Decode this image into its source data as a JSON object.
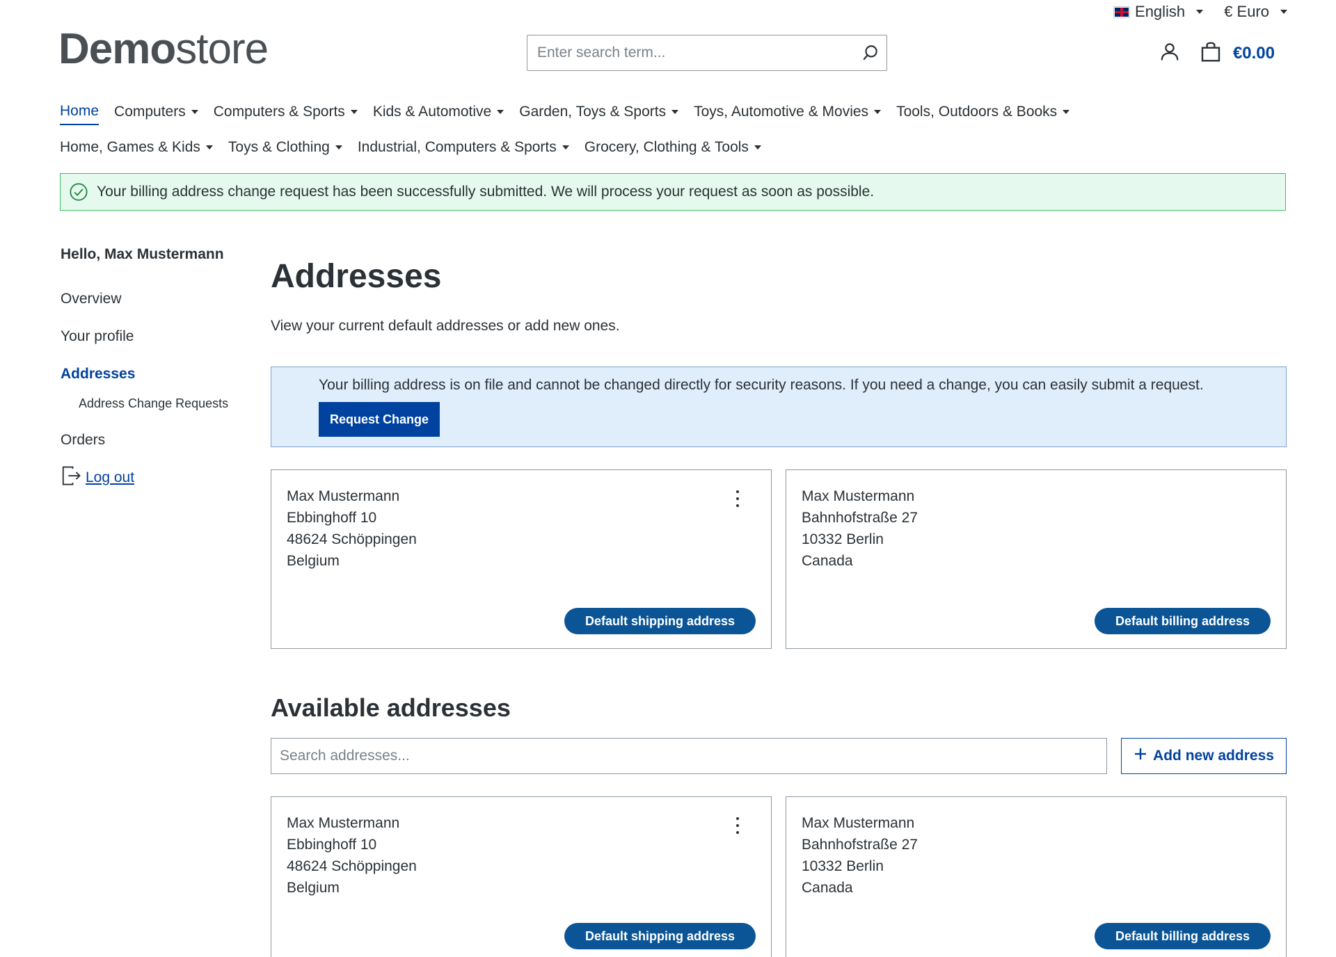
{
  "topbar": {
    "language": "English",
    "currency": "€ Euro"
  },
  "header": {
    "logo_bold": "Demo",
    "logo_light": "store",
    "search_placeholder": "Enter search term...",
    "cart_total": "€0.00"
  },
  "nav": {
    "row1": [
      {
        "label": "Home",
        "active": true
      },
      {
        "label": "Computers"
      },
      {
        "label": "Computers & Sports"
      },
      {
        "label": "Kids & Automotive"
      },
      {
        "label": "Garden, Toys & Sports"
      },
      {
        "label": "Toys, Automotive & Movies"
      },
      {
        "label": "Tools, Outdoors & Books"
      }
    ],
    "row2": [
      {
        "label": "Home, Games & Kids"
      },
      {
        "label": "Toys & Clothing"
      },
      {
        "label": "Industrial, Computers & Sports"
      },
      {
        "label": "Grocery, Clothing & Tools"
      }
    ]
  },
  "success_alert": "Your billing address change request has been successfully submitted. We will process your request as soon as possible.",
  "sidebar": {
    "greeting": "Hello, Max Mustermann",
    "overview": "Overview",
    "profile": "Your profile",
    "addresses": "Addresses",
    "address_change_requests": "Address Change Requests",
    "orders": "Orders",
    "logout": "Log out"
  },
  "main": {
    "title": "Addresses",
    "lead": "View your current default addresses or add new ones.",
    "info_text": "Your billing address is on file and cannot be changed directly for security reasons. If you need a change, you can easily submit a request.",
    "request_change_label": "Request Change",
    "default_cards": [
      {
        "name": "Max Mustermann",
        "street": "Ebbinghoff 10",
        "city": "48624 Schöppingen",
        "country": "Belgium",
        "button": "Default shipping address"
      },
      {
        "name": "Max Mustermann",
        "street": "Bahnhofstraße 27",
        "city": "10332 Berlin",
        "country": "Canada",
        "button": "Default billing address"
      }
    ],
    "available_title": "Available addresses",
    "search_addresses_placeholder": "Search addresses...",
    "add_new_label": "Add new address",
    "available_cards": [
      {
        "name": "Max Mustermann",
        "street": "Ebbinghoff 10",
        "city": "48624 Schöppingen",
        "country": "Belgium",
        "button": "Default shipping address"
      },
      {
        "name": "Max Mustermann",
        "street": "Bahnhofstraße 27",
        "city": "10332 Berlin",
        "country": "Canada",
        "button": "Default billing address"
      }
    ]
  },
  "colors": {
    "primary": "#0042a0",
    "success_bg": "#e5f9ee",
    "success_border": "#3cc261",
    "info_bg": "#e0eefc",
    "badge": "#0b5596"
  }
}
